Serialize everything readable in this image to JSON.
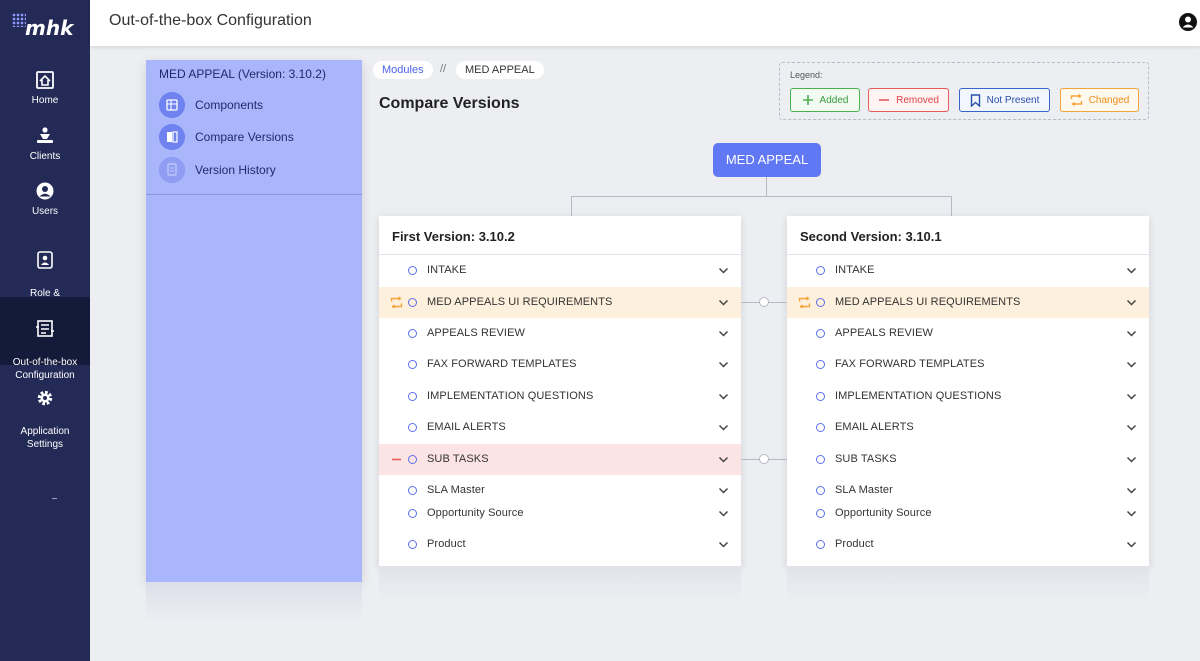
{
  "app": {
    "logo_text": "mhk",
    "header_title": "Out-of-the-box Configuration"
  },
  "nav": {
    "items": [
      {
        "label": "Home",
        "icon": "home-icon"
      },
      {
        "label": "Clients",
        "icon": "clients-icon"
      },
      {
        "label": "Users",
        "icon": "users-icon"
      },
      {
        "label": "Role &\nPermission",
        "icon": "role-permission-icon"
      },
      {
        "label": "Out-of-the-box\nConfiguration",
        "icon": "configuration-icon",
        "active": true
      },
      {
        "label": "Application\nSettings",
        "icon": "gear-icon"
      }
    ]
  },
  "sidepanel": {
    "title": "MED APPEAL (Version: 3.10.2)",
    "items": [
      {
        "label": "Components",
        "icon": "components-icon"
      },
      {
        "label": "Compare Versions",
        "icon": "compare-versions-icon"
      },
      {
        "label": "Version History",
        "icon": "version-history-icon"
      }
    ]
  },
  "breadcrumb": {
    "modules": "Modules",
    "separator": "//",
    "current": "MED APPEAL"
  },
  "page_title": "Compare Versions",
  "legend": {
    "label": "Legend:",
    "added": "Added",
    "removed": "Removed",
    "not_present": "Not Present",
    "changed": "Changed"
  },
  "tree": {
    "root": "MED APPEAL"
  },
  "first_version": {
    "title": "First Version: 3.10.2",
    "rows": [
      {
        "label": "INTAKE",
        "status": "none"
      },
      {
        "label": "MED APPEALS UI REQUIREMENTS",
        "status": "changed"
      },
      {
        "label": "APPEALS REVIEW",
        "status": "none"
      },
      {
        "label": "FAX FORWARD TEMPLATES",
        "status": "none"
      },
      {
        "label": "IMPLEMENTATION QUESTIONS",
        "status": "none"
      },
      {
        "label": "EMAIL ALERTS",
        "status": "none"
      },
      {
        "label": "SUB TASKS",
        "status": "removed"
      },
      {
        "label": "SLA Master",
        "status": "none"
      },
      {
        "label": "Opportunity Source",
        "status": "none"
      },
      {
        "label": "Product",
        "status": "none"
      }
    ]
  },
  "second_version": {
    "title": "Second Version: 3.10.1",
    "rows": [
      {
        "label": "INTAKE",
        "status": "none"
      },
      {
        "label": "MED APPEALS UI REQUIREMENTS",
        "status": "changed"
      },
      {
        "label": "APPEALS REVIEW",
        "status": "none"
      },
      {
        "label": "FAX FORWARD TEMPLATES",
        "status": "none"
      },
      {
        "label": "IMPLEMENTATION QUESTIONS",
        "status": "none"
      },
      {
        "label": "EMAIL ALERTS",
        "status": "none"
      },
      {
        "label": "SUB TASKS",
        "status": "none"
      },
      {
        "label": "SLA Master",
        "status": "none"
      },
      {
        "label": "Opportunity Source",
        "status": "none"
      },
      {
        "label": "Product",
        "status": "none"
      }
    ]
  },
  "colors": {
    "nav_bg": "#222a55",
    "accent": "#6178f4",
    "changed": "#f3a43c",
    "removed": "#e35b5b",
    "added": "#4caf50",
    "not_present": "#3a64c9"
  }
}
